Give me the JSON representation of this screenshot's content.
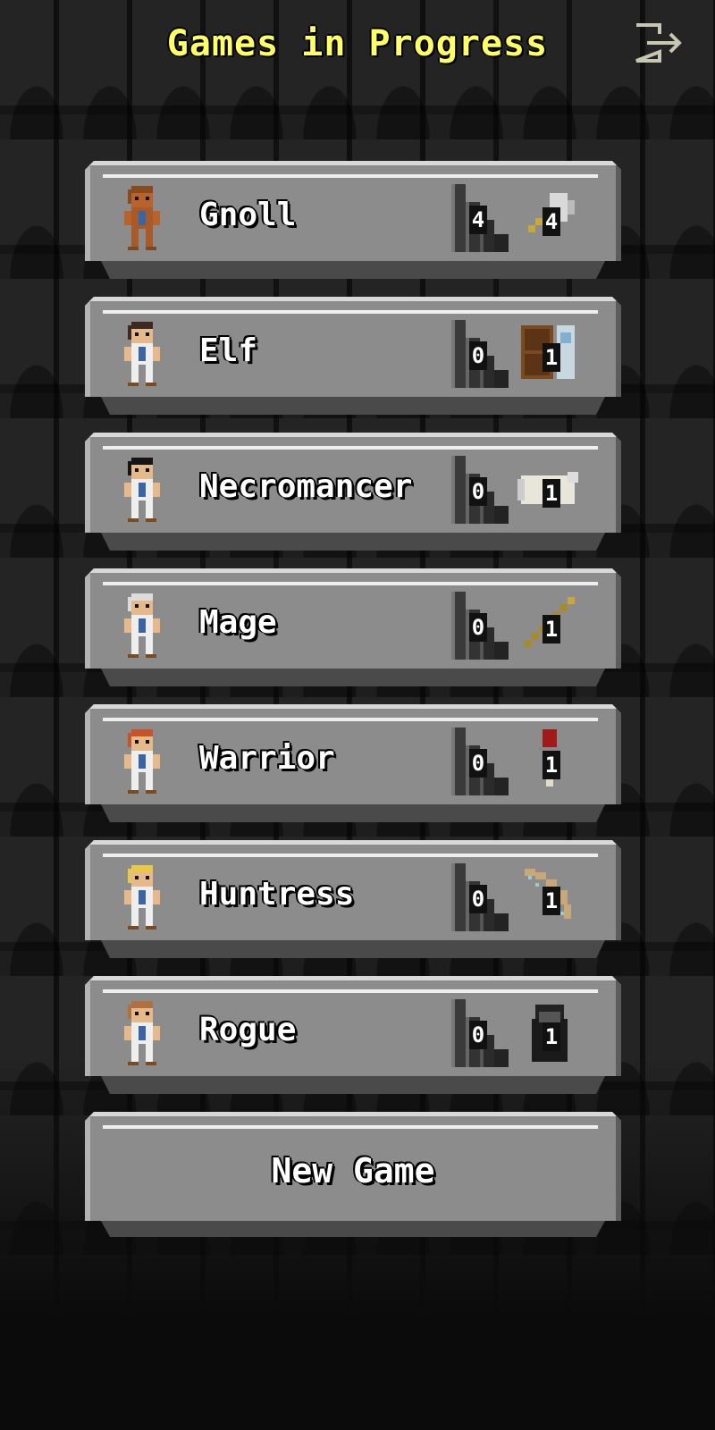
{
  "header": {
    "title": "Games in Progress",
    "exit_icon": "exit-door-arrow-icon"
  },
  "games": [
    {
      "name": "Gnoll",
      "depth": "4",
      "item_level": "4",
      "item_icon": "axe-icon",
      "hero_colors": {
        "skin": "#b7632b",
        "shirt": "#a85a28",
        "hair": "#8a4a20"
      }
    },
    {
      "name": "Elf",
      "depth": "0",
      "item_level": "1",
      "item_icon": "spellbook-icon",
      "hero_colors": {
        "skin": "#e6b98a",
        "shirt": "#eeeeee",
        "hair": "#3a2a20"
      }
    },
    {
      "name": "Necromancer",
      "depth": "0",
      "item_level": "1",
      "item_icon": "bone-icon",
      "hero_colors": {
        "skin": "#e6b98a",
        "shirt": "#eeeeee",
        "hair": "#151515"
      }
    },
    {
      "name": "Mage",
      "depth": "0",
      "item_level": "1",
      "item_icon": "staff-icon",
      "hero_colors": {
        "skin": "#e6b98a",
        "shirt": "#eeeeee",
        "hair": "#dcdcdc"
      }
    },
    {
      "name": "Warrior",
      "depth": "0",
      "item_level": "1",
      "item_icon": "sword-icon",
      "hero_colors": {
        "skin": "#e6b98a",
        "shirt": "#eeeeee",
        "hair": "#c6542a"
      }
    },
    {
      "name": "Huntress",
      "depth": "0",
      "item_level": "1",
      "item_icon": "bow-icon",
      "hero_colors": {
        "skin": "#e6b98a",
        "shirt": "#eeeeee",
        "hair": "#e8c84a"
      }
    },
    {
      "name": "Rogue",
      "depth": "0",
      "item_level": "1",
      "item_icon": "cloak-icon",
      "hero_colors": {
        "skin": "#e6b98a",
        "shirt": "#eeeeee",
        "hair": "#b07040"
      }
    }
  ],
  "new_game": {
    "label": "New Game"
  },
  "colors": {
    "title": "#ffff66",
    "panel": "#8c8c8c",
    "background": "#0b0b0b"
  }
}
